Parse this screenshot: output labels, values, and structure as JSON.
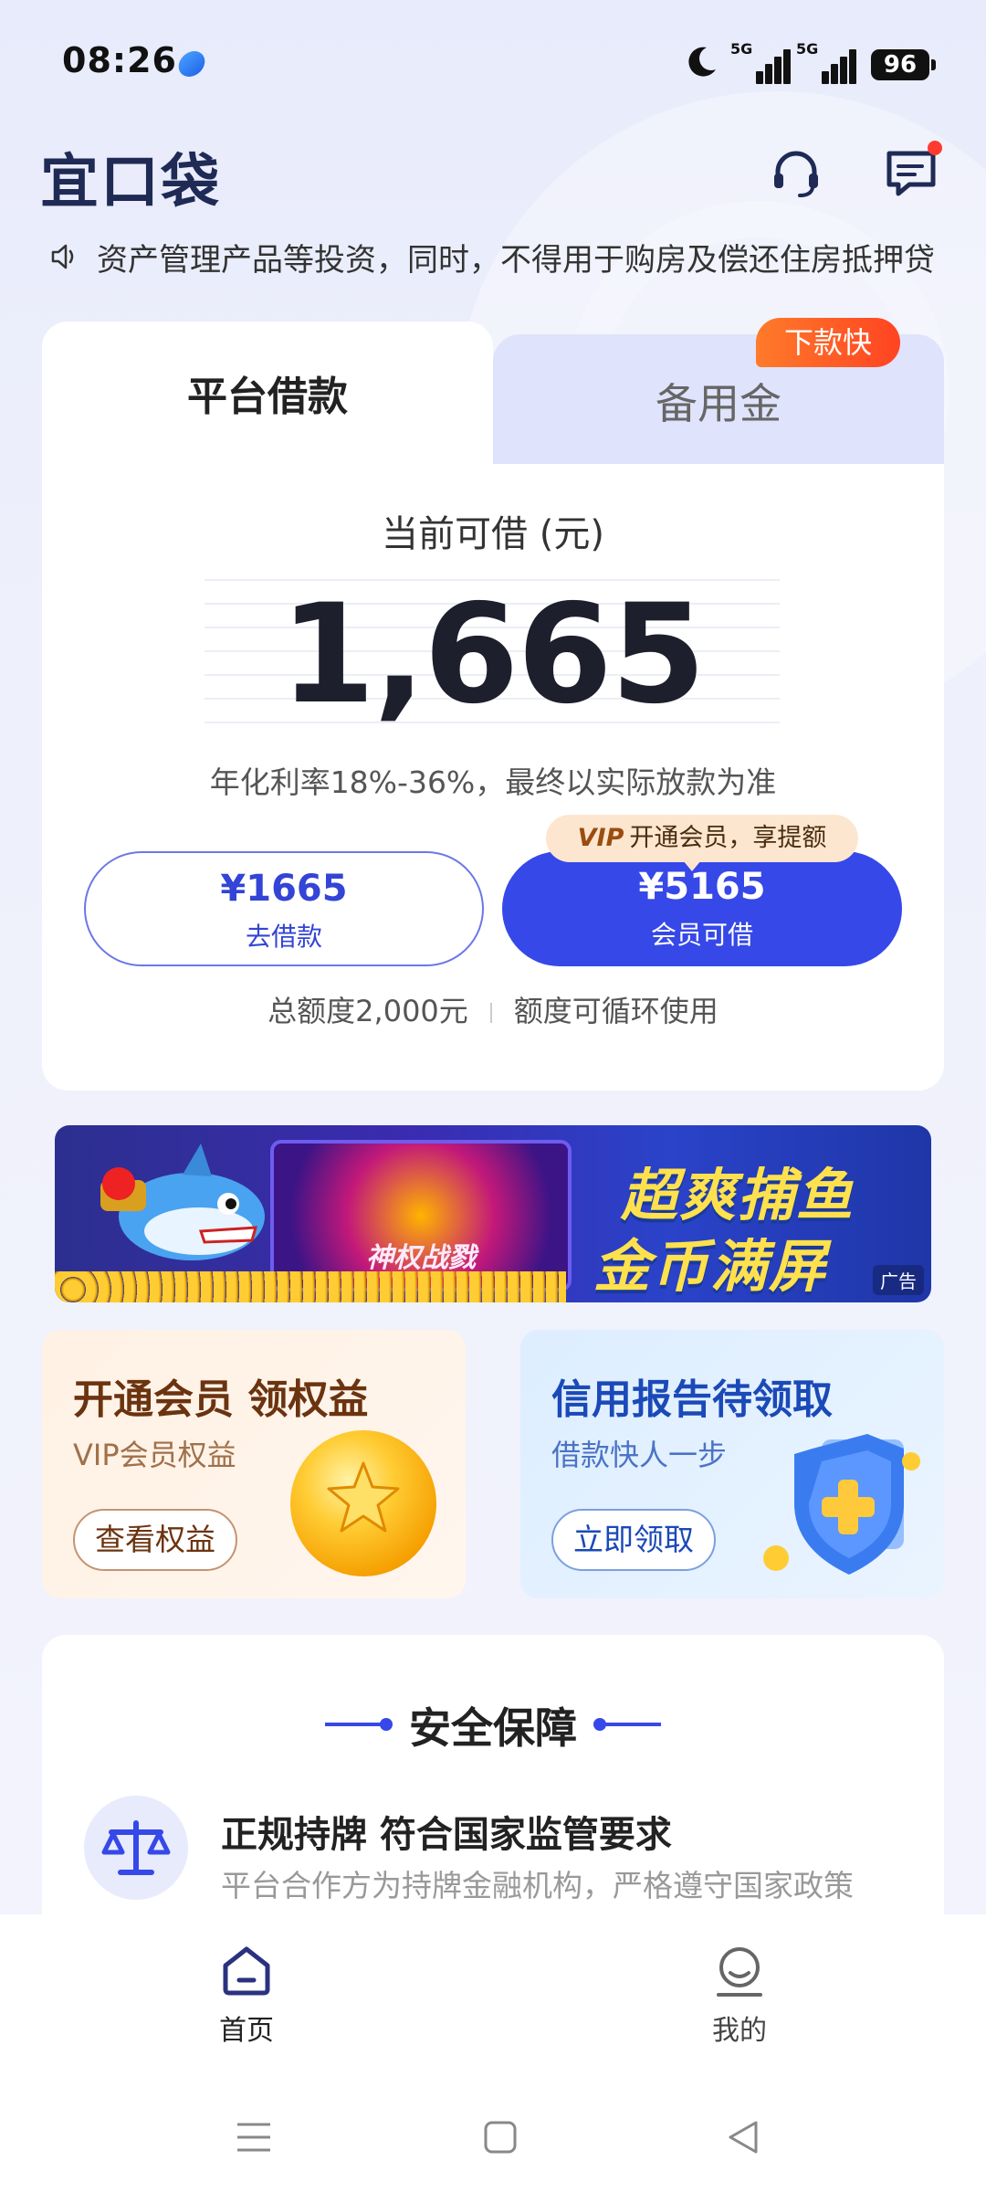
{
  "status_bar": {
    "time": "08:26",
    "battery": "96",
    "signal1_label": "5G",
    "signal2_label": "5G"
  },
  "header": {
    "logo": "宜口袋",
    "headset_icon": "headset-icon",
    "message_icon": "message-icon"
  },
  "notice": {
    "text": "资产管理产品等投资，同时，不得用于购房及偿还住房抵押贷"
  },
  "tabs": {
    "active": "平台借款",
    "inactive": "备用金",
    "badge": "下款快"
  },
  "loan": {
    "available_label": "当前可借 (元)",
    "amount": "1,665",
    "rate_text": "年化利率18%-36%，最终以实际放款为准",
    "borrow_amount": "¥1665",
    "borrow_label": "去借款",
    "member_amount": "¥5165",
    "member_label": "会员可借",
    "vip_badge": "VIP",
    "vip_tip": "开通会员，享提额",
    "total_limit": "总额度2,000元",
    "recycle_text": "额度可循环使用"
  },
  "banner": {
    "panel_text": "神权战戮",
    "headline_line1": "超爽捕鱼",
    "headline_line2": "金币满屏",
    "ad_label": "广告"
  },
  "promos": {
    "vip": {
      "title": "开通会员 领权益",
      "desc": "VIP会员权益",
      "button": "查看权益"
    },
    "credit": {
      "title": "信用报告待领取",
      "desc": "借款快人一步",
      "button": "立即领取"
    }
  },
  "safety": {
    "title": "安全保障",
    "item_title": "正规持牌 符合国家监管要求",
    "item_desc": "平台合作方为持牌金融机构，严格遵守国家政策"
  },
  "bottom_nav": {
    "home": "首页",
    "mine": "我的"
  },
  "colors": {
    "primary": "#3648e8",
    "badge_orange": "#ff5a26",
    "page_bg": "#eef0fb"
  }
}
